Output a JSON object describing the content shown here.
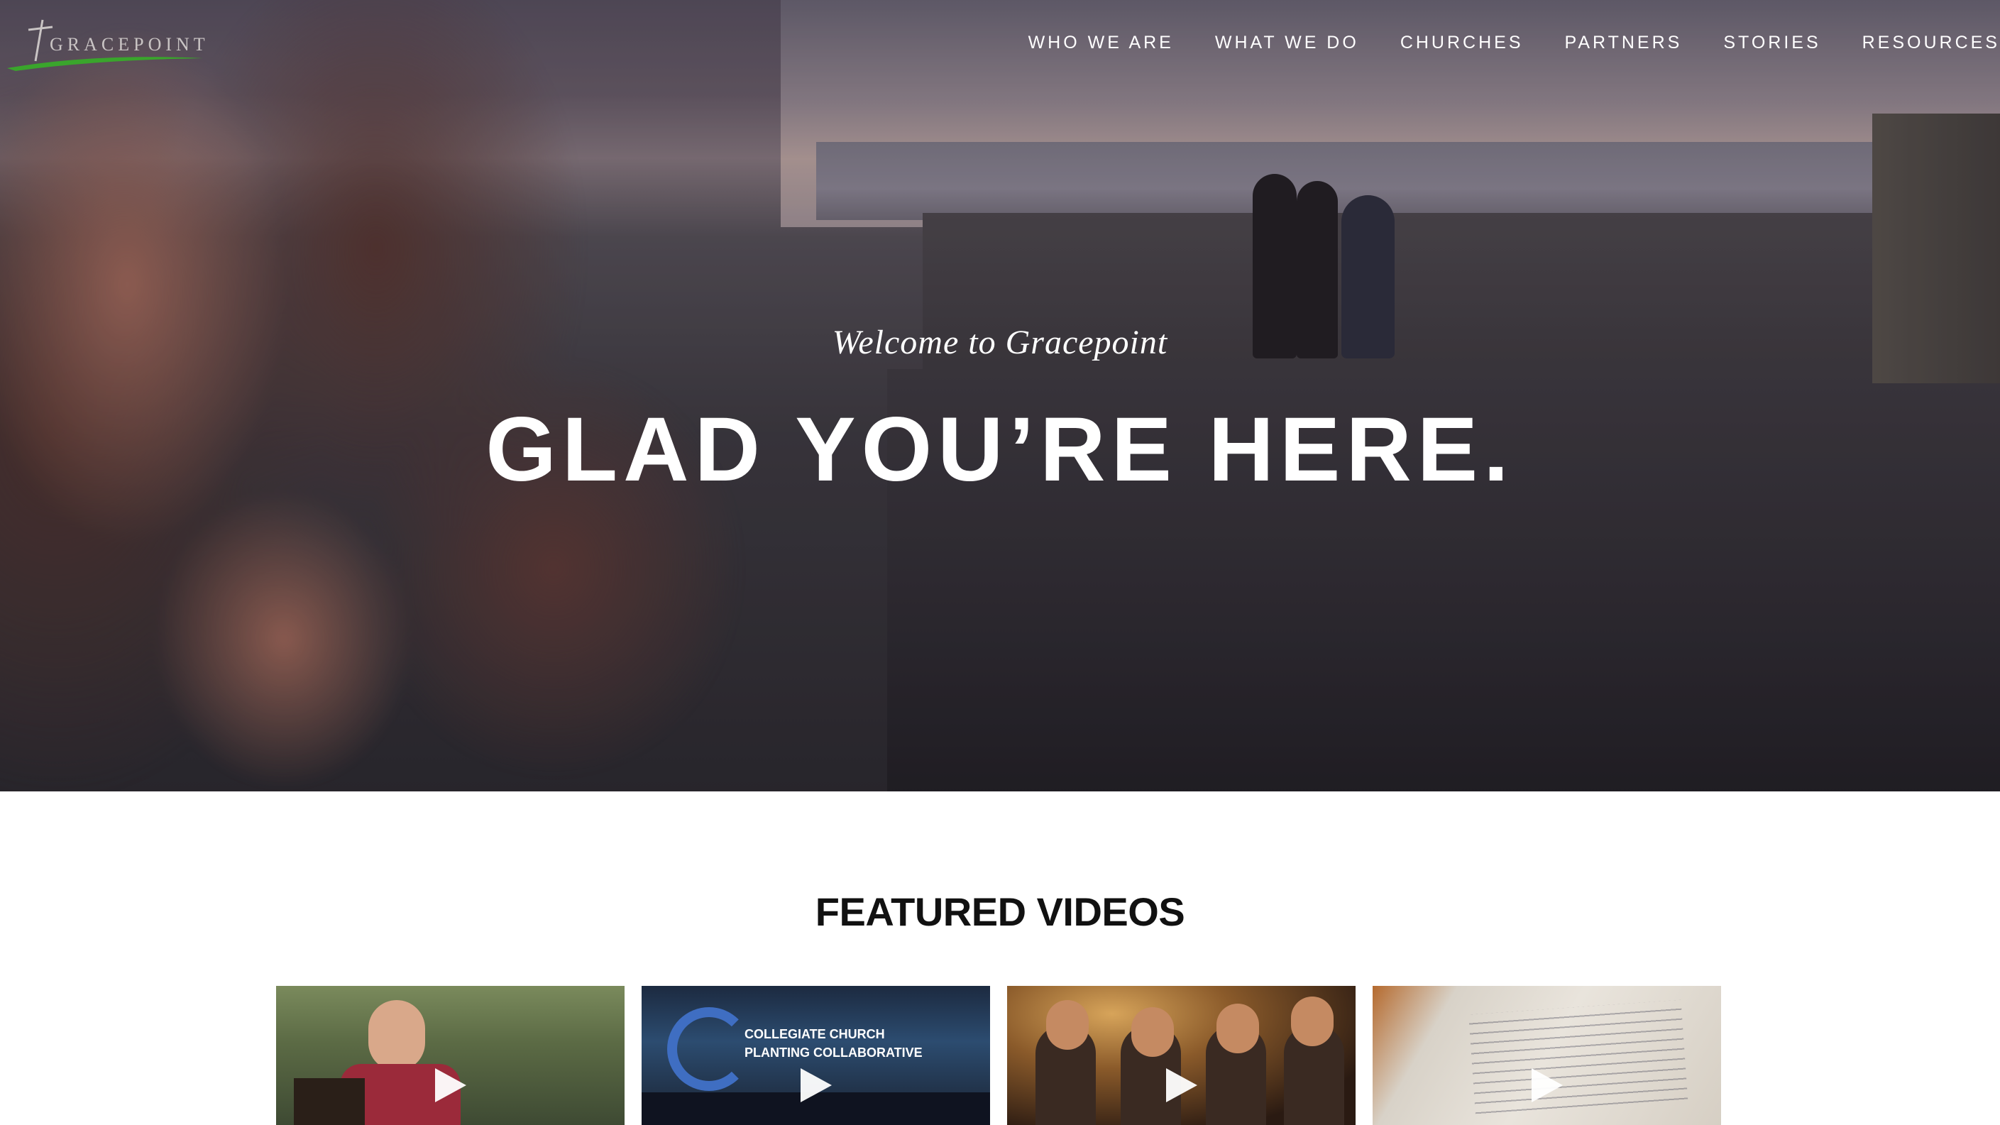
{
  "logo": {
    "text": "GRACEPOINT",
    "accent_color": "#3aa52c"
  },
  "nav": {
    "items": [
      {
        "label": "WHO WE ARE"
      },
      {
        "label": "WHAT WE DO"
      },
      {
        "label": "CHURCHES"
      },
      {
        "label": "PARTNERS"
      },
      {
        "label": "STORIES"
      },
      {
        "label": "RESOURCES"
      }
    ]
  },
  "hero": {
    "subtitle": "Welcome to Gracepoint",
    "title": "GLAD YOU’RE HERE."
  },
  "featured": {
    "title": "FEATURED VIDEOS",
    "videos": [
      {
        "screen_text": ""
      },
      {
        "screen_text_line1": "COLLEGIATE CHURCH",
        "screen_text_line2": "PLANTING COLLABORATIVE"
      },
      {
        "screen_text": ""
      },
      {
        "screen_text": ""
      }
    ],
    "play_icon": "play-icon"
  }
}
